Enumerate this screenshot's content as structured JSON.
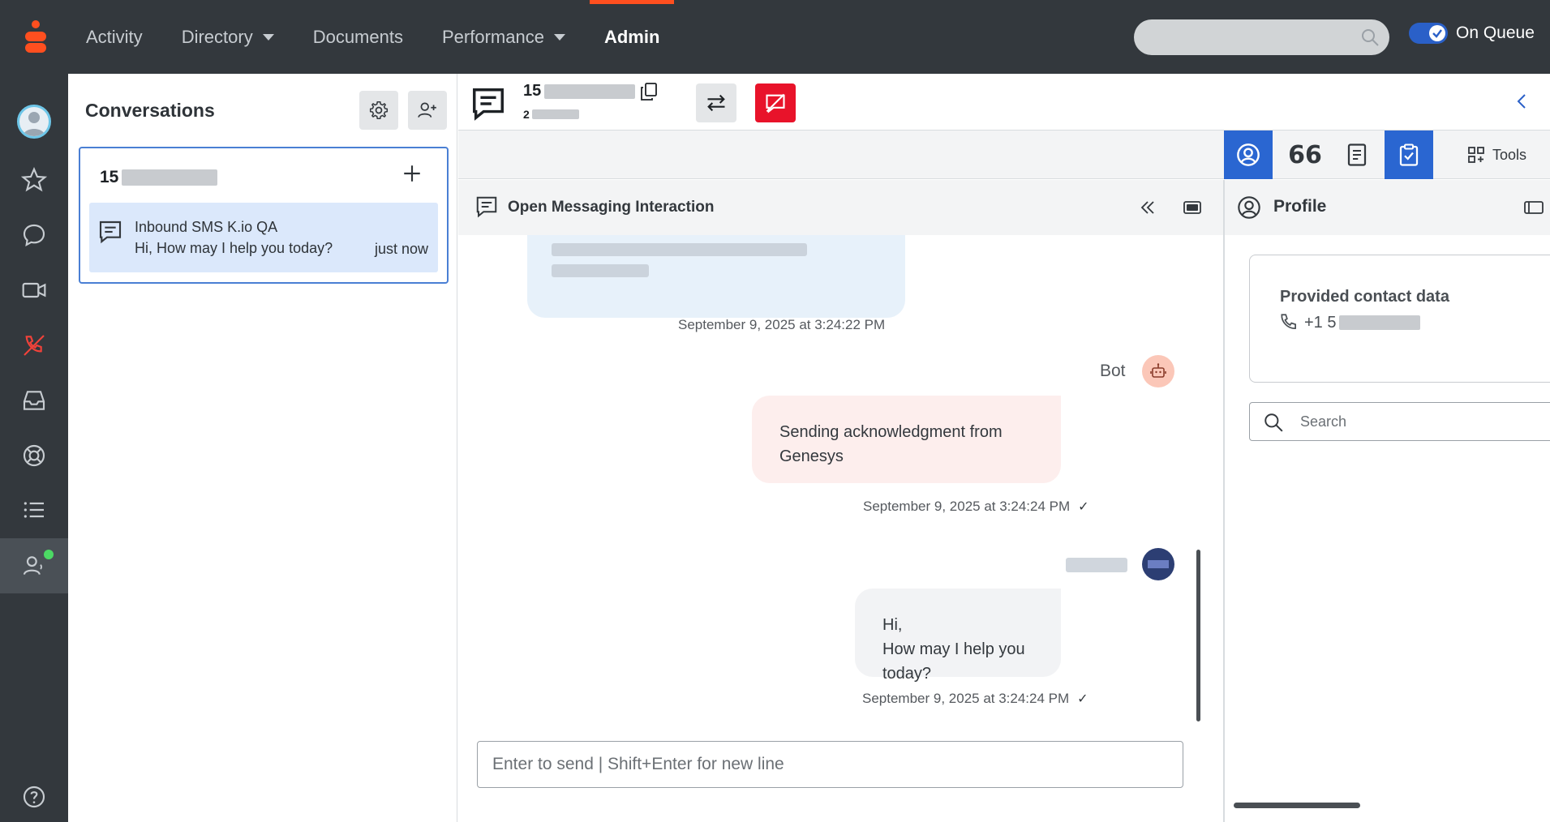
{
  "nav": {
    "items": [
      {
        "label": "Activity"
      },
      {
        "label": "Directory"
      },
      {
        "label": "Documents"
      },
      {
        "label": "Performance"
      },
      {
        "label": "Admin"
      }
    ],
    "queue_label": "On Queue"
  },
  "conversations": {
    "title": "Conversations",
    "card": {
      "header_prefix": "15",
      "item_title": "Inbound SMS K.io QA",
      "item_preview": "Hi, How may I help you today?",
      "item_time": "just now"
    }
  },
  "interaction": {
    "id_prefix": "15",
    "sub_prefix": "2"
  },
  "tools": {
    "tools_label": "Tools",
    "quote_glyph": "66"
  },
  "chat": {
    "title": "Open Messaging Interaction",
    "messages": [
      {
        "timestamp": "September 9, 2025 at 3:24:22 PM"
      },
      {
        "sender": "Bot",
        "text_line1": "Sending acknowledgment from",
        "text_line2": "Genesys",
        "timestamp": "September 9, 2025 at 3:24:24 PM",
        "status": "✓"
      },
      {
        "text_line1": "Hi,",
        "text_line2": "How may I help you today?",
        "timestamp": "September 9, 2025 at 3:24:24 PM",
        "status": "✓"
      }
    ],
    "composer_placeholder": "Enter to send | Shift+Enter for new line"
  },
  "profile": {
    "title": "Profile",
    "contact_heading": "Provided contact data",
    "phone_prefix": "+1 5",
    "search_placeholder": "Search"
  },
  "colors": {
    "topbar": "#33383d",
    "accent": "#ff4f1f",
    "selected": "#2a66d1",
    "end_call": "#e8132a"
  }
}
